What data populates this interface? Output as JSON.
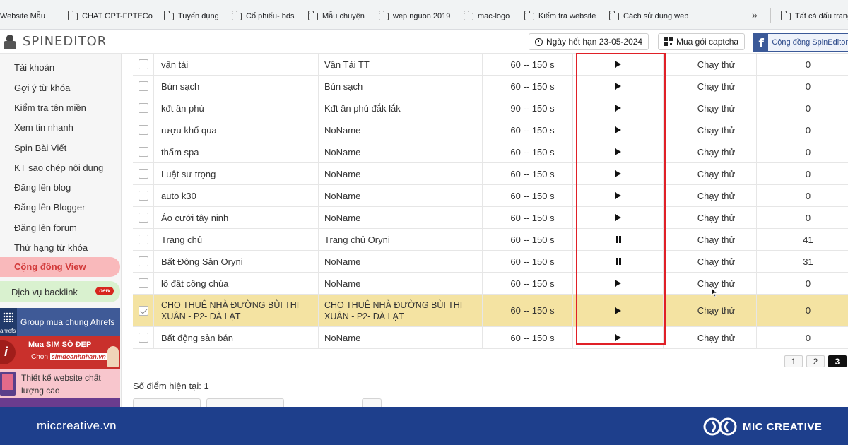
{
  "bookmarks": [
    {
      "label": "Website Mẫu",
      "icon": "folder-icon"
    },
    {
      "label": "CHAT GPT-FPTECo",
      "icon": "folder-icon"
    },
    {
      "label": "Tuyển dụng",
      "icon": "folder-icon"
    },
    {
      "label": "Cổ phiếu- bds",
      "icon": "folder-icon"
    },
    {
      "label": "Mẫu chuyện",
      "icon": "folder-icon"
    },
    {
      "label": "wep nguon 2019",
      "icon": "folder-icon"
    },
    {
      "label": "mac-logo",
      "icon": "folder-icon"
    },
    {
      "label": "Kiểm tra website",
      "icon": "folder-icon"
    },
    {
      "label": "Cách sử dụng web",
      "icon": "folder-icon"
    },
    {
      "label": "Tất cả dấu trang",
      "icon": "folder-icon"
    }
  ],
  "bookmarks_more": "»",
  "header": {
    "logo_text": "SPINEDITOR",
    "expiry_label": "Ngày hết hạn 23-05-2024",
    "captcha_label": "Mua gói captcha",
    "community_label": "Cộng đồng SpinEditor"
  },
  "sidebar": {
    "items": [
      {
        "label": "Tài khoản"
      },
      {
        "label": "Gợi ý từ khóa"
      },
      {
        "label": "Kiểm tra tên miền"
      },
      {
        "label": "Xem tin nhanh"
      },
      {
        "label": "Spin Bài Viết"
      },
      {
        "label": "KT sao chép nội dung"
      },
      {
        "label": "Đăng lên blog"
      },
      {
        "label": "Đăng lên Blogger"
      },
      {
        "label": "Đăng lên forum"
      },
      {
        "label": "Thứ hạng từ khóa"
      }
    ],
    "active_item": "Cộng đồng View",
    "backlink_item": "Dịch vụ backlink",
    "new_badge": "new",
    "promo_ahrefs": {
      "logo_text": "ahrefs",
      "label": "Group mua chung Ahrefs"
    },
    "promo_sim": {
      "title": "Mua SIM SỐ ĐẸP",
      "prefix": "Chọn",
      "site": "simdoanhnhan.vn"
    },
    "promo_web": {
      "line1": "Thiết kế website chất",
      "line2": "lượng cao"
    }
  },
  "table": {
    "rows": [
      {
        "checked": false,
        "keyword": "vận tải",
        "name": "Vận Tải TT",
        "time": "60 -- 150 s",
        "state": "play",
        "run": "Chạy thử",
        "count": "0"
      },
      {
        "checked": false,
        "keyword": "Bún sạch",
        "name": "Bún sạch",
        "time": "60 -- 150 s",
        "state": "play",
        "run": "Chạy thử",
        "count": "0"
      },
      {
        "checked": false,
        "keyword": "kđt ân phú",
        "name": "Kđt ân phú đắk lắk",
        "time": "90 -- 150 s",
        "state": "play",
        "run": "Chạy thử",
        "count": "0"
      },
      {
        "checked": false,
        "keyword": "rượu khổ qua",
        "name": "NoName",
        "time": "60 -- 150 s",
        "state": "play",
        "run": "Chạy thử",
        "count": "0"
      },
      {
        "checked": false,
        "keyword": "thẩm spa",
        "name": "NoName",
        "time": "60 -- 150 s",
        "state": "play",
        "run": "Chạy thử",
        "count": "0"
      },
      {
        "checked": false,
        "keyword": "Luật sư trọng",
        "name": "NoName",
        "time": "60 -- 150 s",
        "state": "play",
        "run": "Chạy thử",
        "count": "0"
      },
      {
        "checked": false,
        "keyword": "auto k30",
        "name": "NoName",
        "time": "60 -- 150 s",
        "state": "play",
        "run": "Chạy thử",
        "count": "0"
      },
      {
        "checked": false,
        "keyword": "Áo cưới tây ninh",
        "name": "NoName",
        "time": "60 -- 150 s",
        "state": "play",
        "run": "Chạy thử",
        "count": "0"
      },
      {
        "checked": false,
        "keyword": "Trang chủ",
        "name": "Trang chủ Oryni",
        "time": "60 -- 150 s",
        "state": "pause",
        "run": "Chạy thử",
        "count": "41"
      },
      {
        "checked": false,
        "keyword": "Bất Động Sản Oryni",
        "name": "NoName",
        "time": "60 -- 150 s",
        "state": "pause",
        "run": "Chạy thử",
        "count": "31"
      },
      {
        "checked": false,
        "keyword": "lô đất công chúa",
        "name": "NoName",
        "time": "60 -- 150 s",
        "state": "play",
        "run": "Chạy thử",
        "count": "0"
      },
      {
        "checked": true,
        "keyword": "CHO THUÊ NHÀ ĐƯỜNG BÙI THỊ XUÂN - P2- ĐÀ LẠT",
        "name": "CHO THUÊ NHÀ ĐƯỜNG BÙI THỊ XUÂN - P2- ĐÀ LẠT",
        "time": "60 -- 150 s",
        "state": "play",
        "run": "Chạy thử",
        "count": "0"
      },
      {
        "checked": false,
        "keyword": "Bất động sản bán",
        "name": "NoName",
        "time": "60 -- 150 s",
        "state": "play",
        "run": "Chạy thử",
        "count": "0"
      }
    ]
  },
  "pagination": {
    "pages": [
      "1",
      "2",
      "3"
    ],
    "current": "3"
  },
  "points_label": "Số điểm hiện tại: 1",
  "footer": {
    "site": "miccreative.vn",
    "brand": "MIC CREATIVE"
  },
  "colors": {
    "highlight_row": "#f4e3a2",
    "red_box": "#e02027",
    "footer_bg": "#1e3f8c",
    "active_nav": "#f9b9bb",
    "backlink_nav": "#d9f1cf"
  }
}
